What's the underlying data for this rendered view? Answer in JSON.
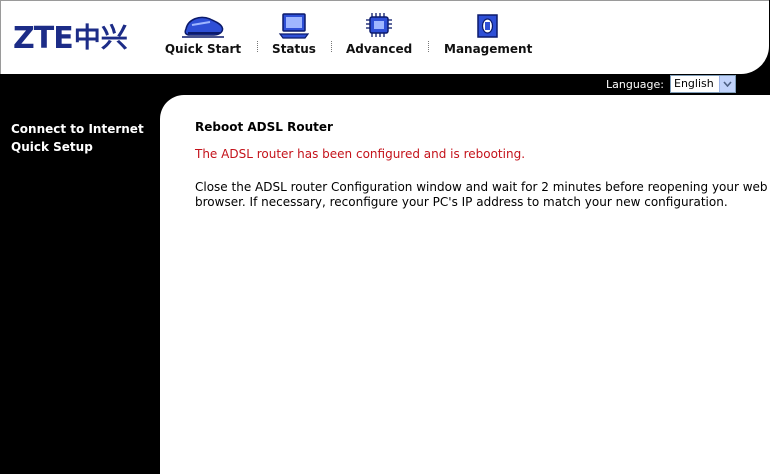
{
  "logo": {
    "latin": "ZTE",
    "cjk": "中兴"
  },
  "nav": [
    {
      "label": "Quick Start",
      "icon": "sneaker-icon"
    },
    {
      "label": "Status",
      "icon": "monitor-icon"
    },
    {
      "label": "Advanced",
      "icon": "chip-icon"
    },
    {
      "label": "Management",
      "icon": "book-icon"
    }
  ],
  "language": {
    "label": "Language:",
    "selected": "English"
  },
  "sidebar": {
    "items": [
      "Connect to Internet",
      "Quick Setup"
    ]
  },
  "content": {
    "title": "Reboot ADSL Router",
    "status": "The ADSL router has been configured and is rebooting.",
    "info": "Close the ADSL router Configuration window and wait for 2 minutes before reopening your web browser. If necessary, reconfigure your PC's IP address to match your new configuration."
  },
  "colors": {
    "logo": "#1c2c87",
    "status_text": "#c4121a",
    "background": "#000000"
  }
}
